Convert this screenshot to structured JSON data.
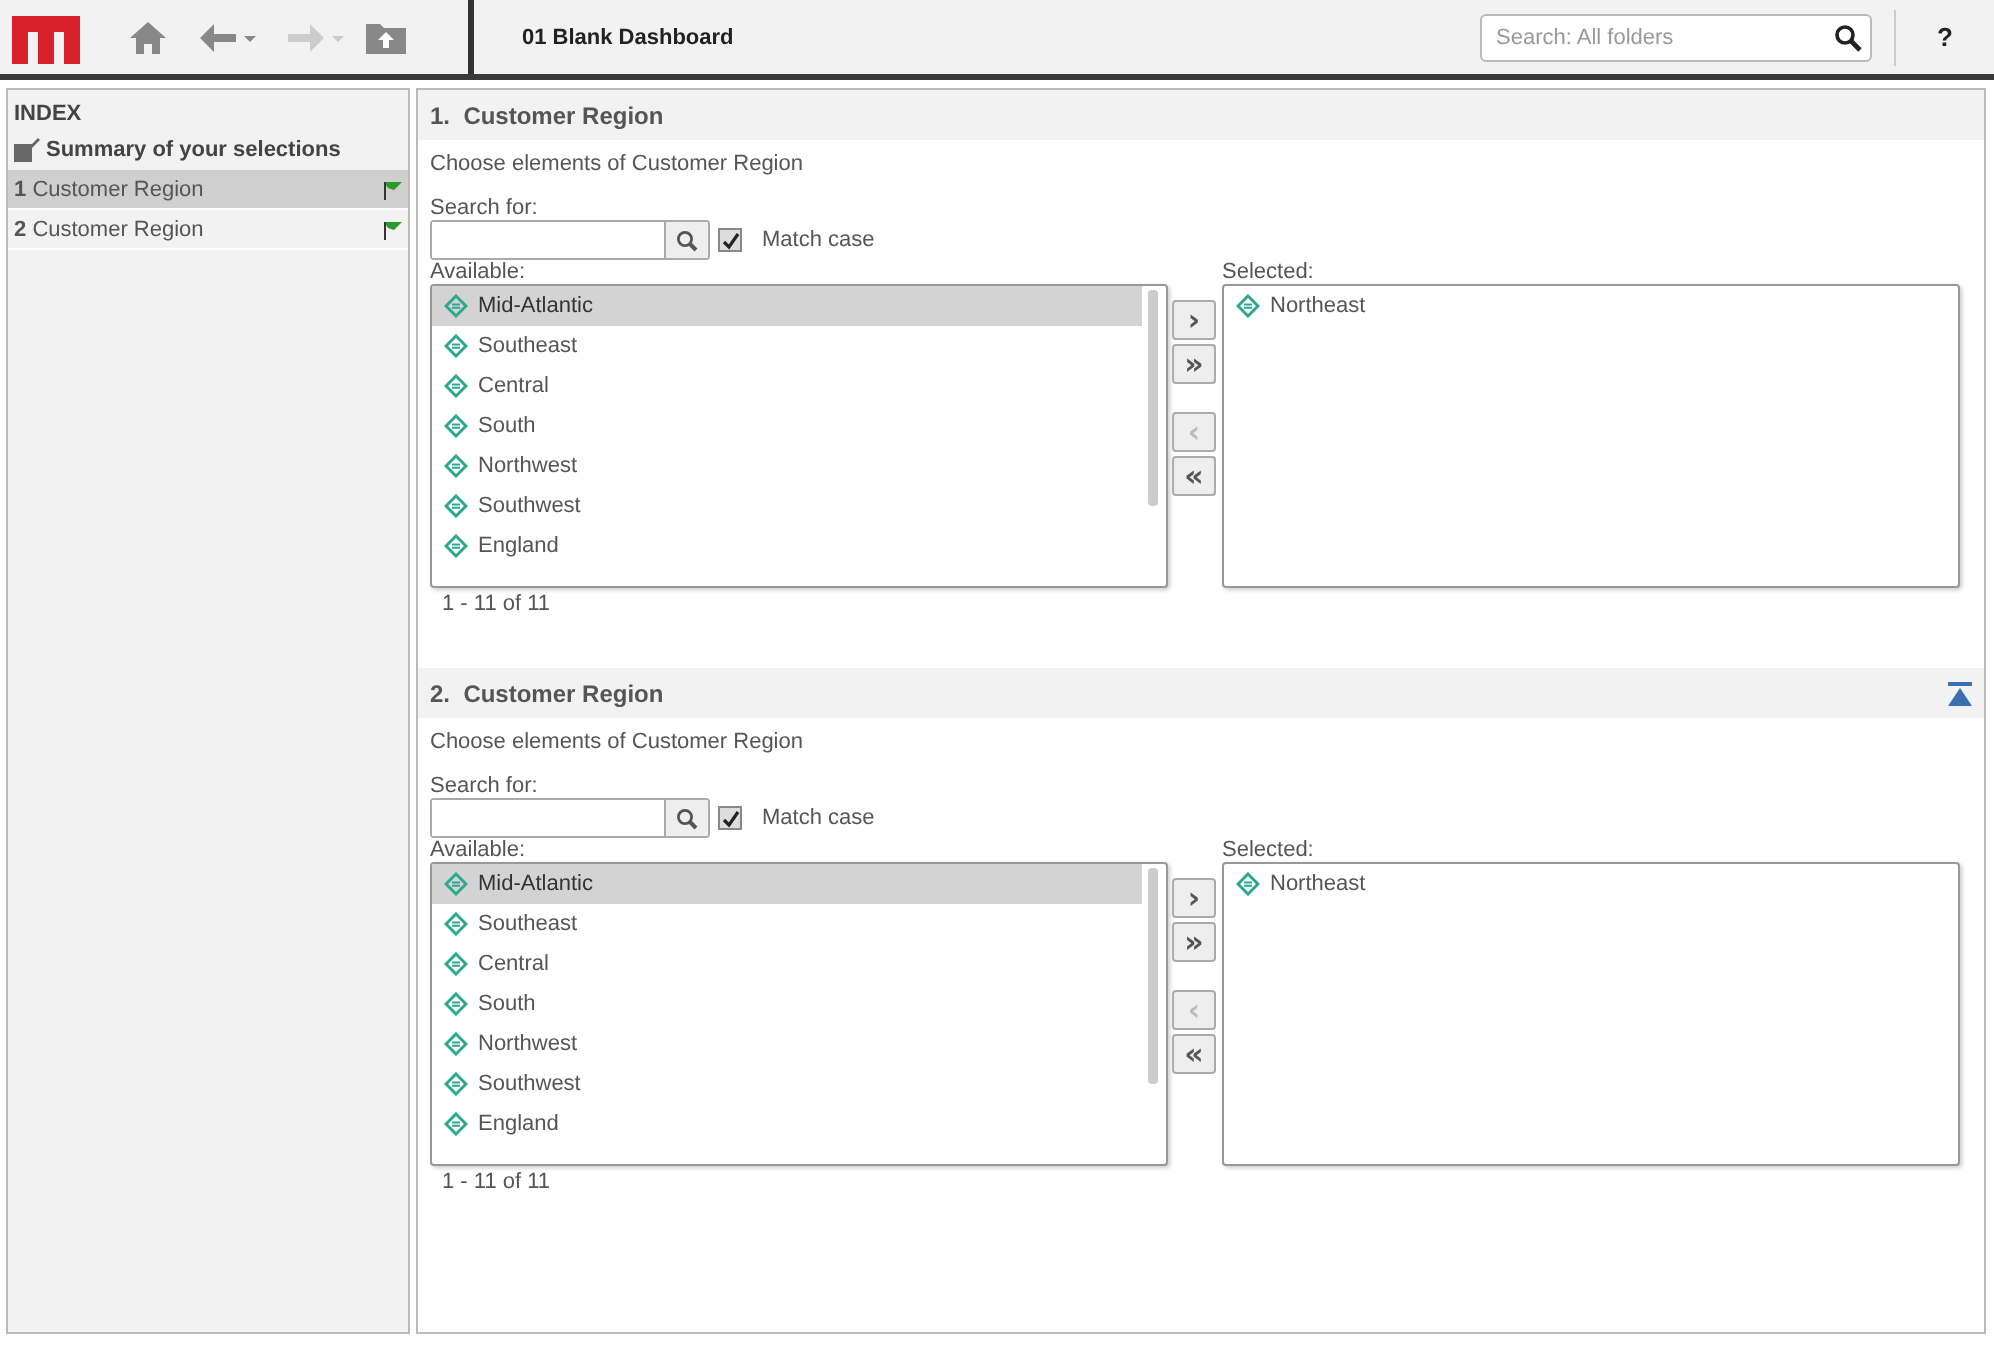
{
  "toolbar": {
    "breadcrumb": "01 Blank Dashboard",
    "search": {
      "placeholder": "Search: All folders"
    },
    "help": "?"
  },
  "sidebar": {
    "title": "INDEX",
    "summary": "Summary of your selections",
    "items": [
      {
        "number": "1",
        "label": "Customer Region",
        "selected": true
      },
      {
        "number": "2",
        "label": "Customer Region",
        "selected": false
      }
    ]
  },
  "sections": [
    {
      "number": "1.",
      "title": "Customer Region",
      "show_top_button": false,
      "prompt": "Choose elements of Customer Region",
      "search_label": "Search for:",
      "match_case": {
        "label": "Match case",
        "checked": true
      },
      "available_label": "Available:",
      "available": [
        {
          "label": "Mid-Atlantic",
          "selected": true
        },
        {
          "label": "Southeast",
          "selected": false
        },
        {
          "label": "Central",
          "selected": false
        },
        {
          "label": "South",
          "selected": false
        },
        {
          "label": "Northwest",
          "selected": false
        },
        {
          "label": "Southwest",
          "selected": false
        },
        {
          "label": "England",
          "selected": false
        }
      ],
      "buttons": [
        {
          "symbol": "›",
          "disabled": false
        },
        {
          "symbol": "»",
          "disabled": false
        },
        {
          "symbol": "‹",
          "disabled": true
        },
        {
          "symbol": "«",
          "disabled": false
        }
      ],
      "pager": "1 - 11 of 11",
      "selected_label": "Selected:",
      "selected": [
        {
          "label": "Northeast"
        }
      ]
    },
    {
      "number": "2.",
      "title": "Customer Region",
      "show_top_button": true,
      "prompt": "Choose elements of Customer Region",
      "search_label": "Search for:",
      "match_case": {
        "label": "Match case",
        "checked": true
      },
      "available_label": "Available:",
      "available": [
        {
          "label": "Mid-Atlantic",
          "selected": true
        },
        {
          "label": "Southeast",
          "selected": false
        },
        {
          "label": "Central",
          "selected": false
        },
        {
          "label": "South",
          "selected": false
        },
        {
          "label": "Northwest",
          "selected": false
        },
        {
          "label": "Southwest",
          "selected": false
        },
        {
          "label": "England",
          "selected": false
        }
      ],
      "buttons": [
        {
          "symbol": "›",
          "disabled": false
        },
        {
          "symbol": "»",
          "disabled": false
        },
        {
          "symbol": "‹",
          "disabled": true
        },
        {
          "symbol": "«",
          "disabled": false
        }
      ],
      "pager": "1 - 11 of 11",
      "selected_label": "Selected:",
      "selected": [
        {
          "label": "Northeast"
        }
      ]
    }
  ]
}
